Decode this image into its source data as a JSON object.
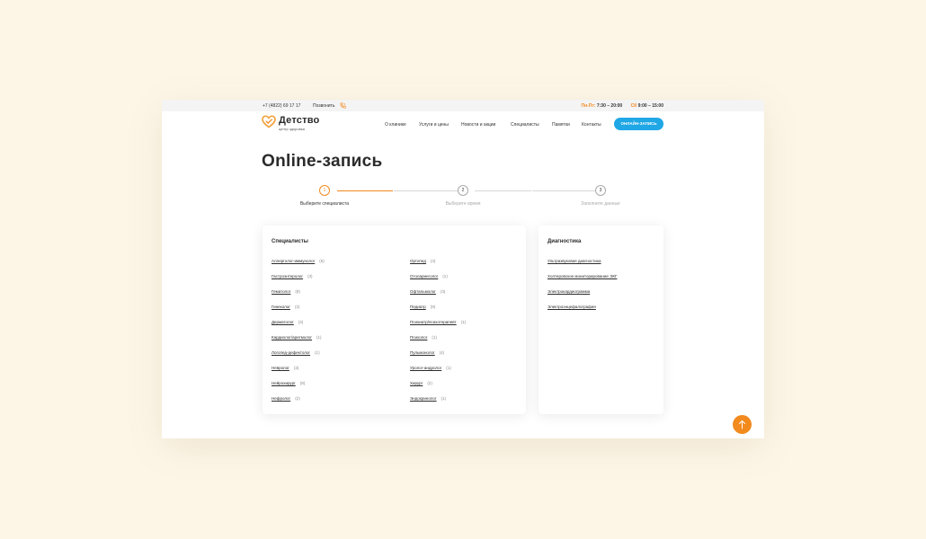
{
  "topbar": {
    "phone": "+7 (4822) 69 17 17",
    "call_label": "Позвонить",
    "weekday_label": "Пн-Пт:",
    "weekday_hours": "7:30 – 20:00",
    "saturday_label": "Сб",
    "saturday_hours": "9:00 – 15:00"
  },
  "logo": {
    "name": "Детство",
    "subtitle": "центр здоровья"
  },
  "nav": {
    "items": [
      "О клинике",
      "Услуги и цены",
      "Новости и акции",
      "Специалисты",
      "Памятки",
      "Контакты"
    ],
    "cta": "ОНЛАЙН-ЗАПИСЬ"
  },
  "page": {
    "title": "Online-запись"
  },
  "steps": [
    {
      "number": "1",
      "label": "Выберите специалиста",
      "active": true
    },
    {
      "number": "2",
      "label": "Выберите время",
      "active": false
    },
    {
      "number": "3",
      "label": "Заполните данные",
      "active": false
    }
  ],
  "specialists": {
    "title": "Специалисты",
    "left": [
      {
        "name": "Аллерголог-иммунолог",
        "count": "(6)"
      },
      {
        "name": "Гастроэнтеролог",
        "count": "(3)"
      },
      {
        "name": "Гематолог",
        "count": "(8)"
      },
      {
        "name": "Гинеколог",
        "count": "(3)"
      },
      {
        "name": "Дерматолог",
        "count": "(3)"
      },
      {
        "name": "Кардиолог/аритмолог",
        "count": "(1)"
      },
      {
        "name": "Логопед-дефектолог",
        "count": "(1)"
      },
      {
        "name": "Невролог",
        "count": "(3)"
      },
      {
        "name": "Нейрохирург",
        "count": "(8)"
      },
      {
        "name": "Нефролог",
        "count": "(2)"
      }
    ],
    "right": [
      {
        "name": "Ортопед",
        "count": "(4)"
      },
      {
        "name": "Отоларинголог",
        "count": "(1)"
      },
      {
        "name": "Офтальмолог",
        "count": "(3)"
      },
      {
        "name": "Педиатр",
        "count": "(9)"
      },
      {
        "name": "Психиатр/психотерапевт",
        "count": "(1)"
      },
      {
        "name": "Психолог",
        "count": "(1)"
      },
      {
        "name": "Пульмонолог",
        "count": "(4)"
      },
      {
        "name": "Уролог-андролог",
        "count": "(1)"
      },
      {
        "name": "Хирург",
        "count": "(2)"
      },
      {
        "name": "Эндокринолог",
        "count": "(1)"
      }
    ]
  },
  "diagnostics": {
    "title": "Диагностика",
    "items": [
      "Ультразвуковая диагностика",
      "Холтеровское мониторирование ЭКГ",
      "Электрокардиограмма",
      "Электроэнцефалография"
    ]
  },
  "colors": {
    "accent": "#f28a1d",
    "cta": "#1fa7e6",
    "background": "#fdf6e7"
  },
  "icons": {
    "phone": "phone-icon",
    "logo": "heart-logo-icon",
    "scroll_up": "arrow-up-icon"
  }
}
